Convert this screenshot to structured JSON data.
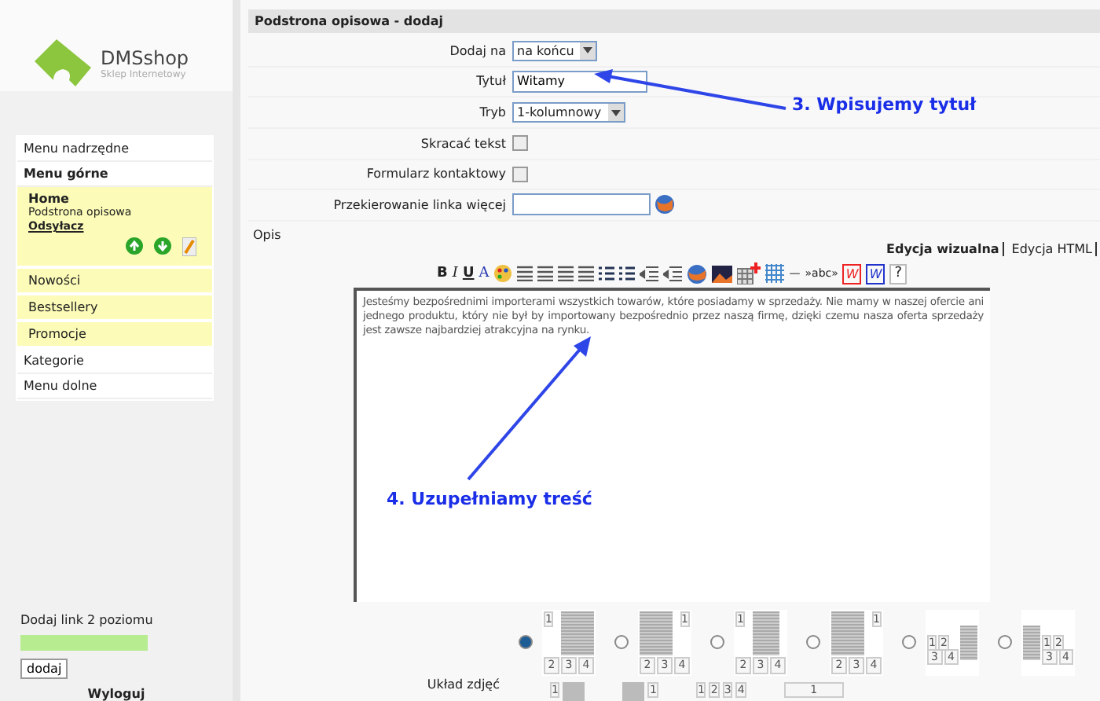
{
  "logo": {
    "name": "DMSshop",
    "tagline": "Sklep Internetowy"
  },
  "menu": [
    {
      "kind": "item",
      "label": "Menu nadrzędne"
    },
    {
      "kind": "heading",
      "label": "Menu górne"
    },
    {
      "kind": "active",
      "label": "Home",
      "sub": "Podstrona opisowa",
      "link": "Odsyłacz"
    },
    {
      "kind": "child",
      "label": "Nowości"
    },
    {
      "kind": "child",
      "label": "Bestsellery"
    },
    {
      "kind": "child",
      "label": "Promocje"
    },
    {
      "kind": "item",
      "label": "Kategorie"
    },
    {
      "kind": "item",
      "label": "Menu dolne"
    }
  ],
  "add_link": {
    "label": "Dodaj link 2 poziomu",
    "button": "dodaj"
  },
  "logout": "Wyloguj",
  "form": {
    "title": "Podstrona opisowa - dodaj",
    "rows": [
      {
        "kind": "select",
        "label": "Dodaj na",
        "value": "na końcu"
      },
      {
        "kind": "text",
        "label": "Tytuł",
        "value": "Witamy"
      },
      {
        "kind": "select",
        "label": "Tryb",
        "value": "1-kolumnowy"
      },
      {
        "kind": "checkbox",
        "label": "Skracać tekst",
        "checked": false
      },
      {
        "kind": "checkbox",
        "label": "Formularz kontaktowy",
        "checked": false
      },
      {
        "kind": "link",
        "label": "Przekierowanie linka więcej",
        "value": ""
      }
    ]
  },
  "editor": {
    "label": "Opis",
    "tabs": [
      {
        "label": "Edycja wizualna",
        "selected": true
      },
      {
        "label": "Edycja HTML",
        "selected": false
      }
    ],
    "toolbar": [
      {
        "kind": "bold",
        "label": "B"
      },
      {
        "kind": "italic",
        "label": "I"
      },
      {
        "kind": "underline",
        "label": "U"
      },
      {
        "kind": "font-color",
        "label": "A"
      },
      {
        "kind": "palette"
      },
      {
        "kind": "align"
      },
      {
        "kind": "align"
      },
      {
        "kind": "align"
      },
      {
        "kind": "align"
      },
      {
        "kind": "list"
      },
      {
        "kind": "list"
      },
      {
        "kind": "indent"
      },
      {
        "kind": "indent"
      },
      {
        "kind": "globe"
      },
      {
        "kind": "image"
      },
      {
        "kind": "table-add"
      },
      {
        "kind": "grid"
      },
      {
        "kind": "text",
        "label": "—"
      },
      {
        "kind": "text",
        "label": "»abc»"
      },
      {
        "kind": "word-red",
        "label": "W"
      },
      {
        "kind": "word-blue",
        "label": "W"
      },
      {
        "kind": "help",
        "label": "?"
      }
    ],
    "content": "Jesteśmy bezpośrednimi importerami wszystkich towarów, które posiadamy w sprzedaży. Nie mamy w naszej ofercie ani jednego produktu, który nie był by importowany bezpośrednio przez naszą firmę, dzięki czemu nasza oferta sprzedaży jest zawsze najbardziej atrakcyjna na rynku."
  },
  "photo_layout": {
    "label": "Układ zdjęć",
    "options": [
      {
        "kind": "top-left",
        "numbers": [
          "1",
          "2",
          "3",
          "4"
        ],
        "selected": true
      },
      {
        "kind": "top-right",
        "numbers": [
          "1",
          "2",
          "3",
          "4"
        ],
        "selected": false
      },
      {
        "kind": "col-left",
        "numbers": [
          "1",
          "2",
          "3",
          "4"
        ],
        "selected": false
      },
      {
        "kind": "col-right",
        "numbers": [
          "1",
          "2",
          "3",
          "4"
        ],
        "selected": false
      },
      {
        "kind": "grid-left",
        "numbers": [
          "1",
          "2",
          "3",
          "4"
        ],
        "selected": false
      },
      {
        "kind": "grid-right",
        "numbers": [
          "1",
          "2",
          "3",
          "4"
        ],
        "selected": false
      }
    ],
    "more": [
      {
        "kind": "top-left",
        "numbers": [
          "1"
        ]
      },
      {
        "kind": "top-right",
        "numbers": [
          "1"
        ]
      },
      {
        "kind": "row",
        "numbers": [
          "1",
          "2",
          "3",
          "4"
        ]
      },
      {
        "kind": "wide",
        "numbers": [
          "1"
        ]
      }
    ]
  },
  "annotations": [
    {
      "kind": "title",
      "text": "3. Wpisujemy tytuł"
    },
    {
      "kind": "content",
      "text": "4. Uzupełniamy treść"
    }
  ]
}
